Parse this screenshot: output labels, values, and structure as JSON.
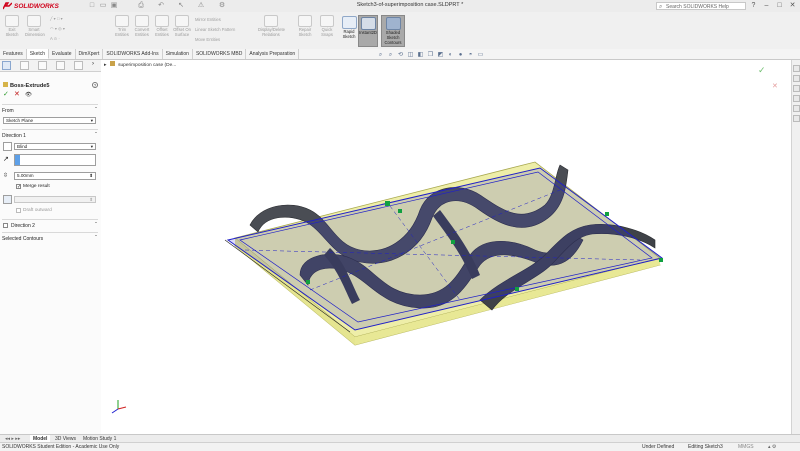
{
  "app": {
    "brand": "SOLIDWORKS",
    "document_title": "Sketch3-of-superimposition case.SLDPRT *",
    "help_search_placeholder": "Search SOLIDWORKS Help",
    "brand_color": "#d0021b"
  },
  "quick_access": [
    "new-icon",
    "open-icon",
    "save-icon",
    "print-icon",
    "undo-icon",
    "select-icon",
    "rebuild-icon",
    "options-icon"
  ],
  "command_manager": {
    "buttons": [
      {
        "label": "Exit Sketch",
        "icon": "exit-sketch-icon"
      },
      {
        "label": "Smart Dimension",
        "icon": "smart-dimension-icon"
      },
      {
        "label": "Trim Entities",
        "icon": "trim-icon"
      },
      {
        "label": "Convert Entities",
        "icon": "convert-icon"
      },
      {
        "label": "Offset Entities",
        "icon": "offset-icon"
      },
      {
        "label": "Offset On Surface",
        "icon": "offset-surface-icon"
      }
    ],
    "small_items": [
      "Mirror Entities",
      "Linear Sketch Pattern",
      "Move Entities"
    ],
    "group2": [
      {
        "label": "Display/Delete Relations",
        "icon": "relations-icon"
      },
      {
        "label": "Repair Sketch",
        "icon": "repair-icon"
      },
      {
        "label": "Quick Snaps",
        "icon": "snap-icon"
      }
    ],
    "big_buttons": [
      {
        "label": "Rapid Sketch",
        "active": false
      },
      {
        "label": "Instant2D",
        "active": true
      },
      {
        "label": "Shaded Sketch Contours",
        "active": true
      }
    ]
  },
  "tabs": [
    {
      "label": "Features",
      "active": false
    },
    {
      "label": "Sketch",
      "active": true
    },
    {
      "label": "Evaluate",
      "active": false
    },
    {
      "label": "DimXpert",
      "active": false
    },
    {
      "label": "SOLIDWORKS Add-Ins",
      "active": false
    },
    {
      "label": "Simulation",
      "active": false
    },
    {
      "label": "SOLIDWORKS MBD",
      "active": false
    },
    {
      "label": "Analysis Preparation",
      "active": false
    }
  ],
  "property_manager": {
    "feature_name": "Boss-Extrude5",
    "help": "?",
    "ok": "✓",
    "cancel": "✕",
    "preview": "👁",
    "from": {
      "title": "From",
      "value": "Sketch Plane"
    },
    "direction1": {
      "title": "Direction 1",
      "end_condition": "Blind",
      "depth": "5.00mm",
      "merge_result_label": "Merge result",
      "merge_result": true,
      "draft_outward_label": "Draft outward",
      "draft_outward": false
    },
    "direction2": {
      "title": "Direction 2",
      "enabled": false
    },
    "selected_contours": {
      "title": "Selected Contours"
    }
  },
  "graphics": {
    "tree_flyout": "superimposition case (De...",
    "model_colors": {
      "body": "#4a4d54",
      "plate": "#e8e89a",
      "sketch": "#2020c8",
      "relation": "#10a040"
    }
  },
  "bottom_tabs": [
    {
      "label": "Model",
      "active": true
    },
    {
      "label": "3D Views",
      "active": false
    },
    {
      "label": "Motion Study 1",
      "active": false
    }
  ],
  "status_bar": {
    "left": "SOLIDWORKS Student Edition - Academic Use Only",
    "state": "Under Defined",
    "editing": "Editing Sketch3",
    "units": "MMGS"
  }
}
